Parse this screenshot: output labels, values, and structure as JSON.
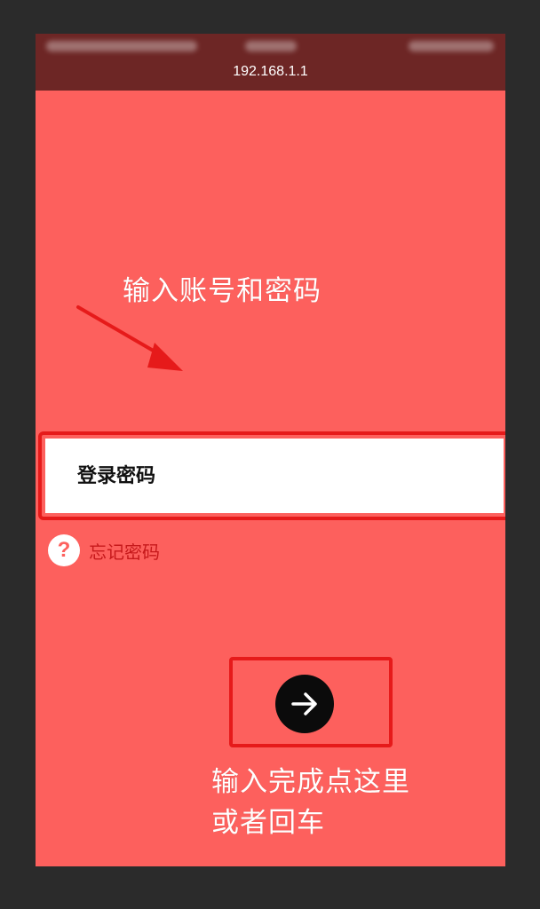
{
  "browser": {
    "url": "192.168.1.1"
  },
  "annotations": {
    "top_caption": "输入账号和密码",
    "bottom_caption_line1": "输入完成点这里",
    "bottom_caption_line2": "或者回车"
  },
  "login": {
    "password_placeholder": "登录密码",
    "password_value": "",
    "forgot_password_label": "忘记密码",
    "help_icon_glyph": "?",
    "submit_icon": "arrow-right-icon"
  },
  "colors": {
    "page_background": "#fd605d",
    "topbar": "#6d2625",
    "highlight_border": "#e61a1a",
    "forgot_text": "#c6191b",
    "submit_button": "#0b0b0b"
  }
}
